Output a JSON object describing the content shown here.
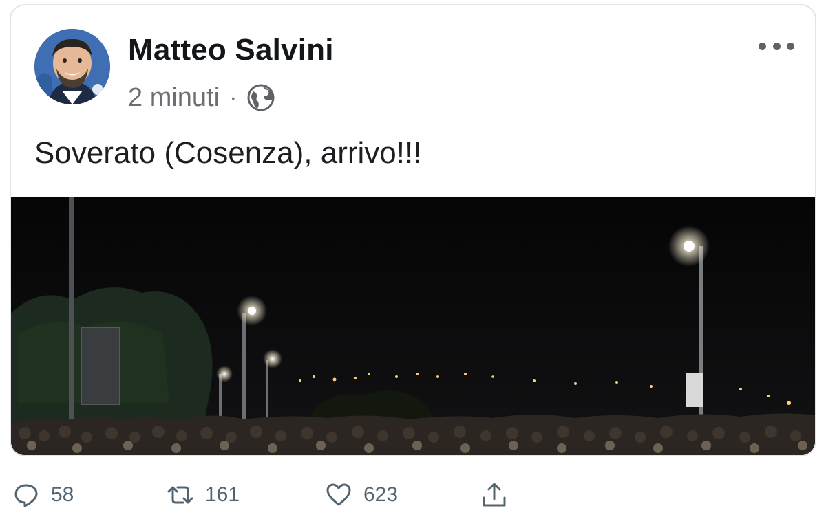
{
  "post": {
    "author": "Matteo Salvini",
    "time": "2 minuti",
    "separator": "·",
    "text": "Soverato (Cosenza), arrivo!!!",
    "privacy_icon": "globe-icon",
    "more_icon": "more-options-icon"
  },
  "actions": {
    "replies": "58",
    "retweets": "161",
    "likes": "623",
    "reply_icon": "reply-icon",
    "retweet_icon": "retweet-icon",
    "like_icon": "heart-icon",
    "share_icon": "share-icon"
  },
  "colors": {
    "text": "#14171a",
    "muted": "#536471",
    "photo_bg": "#070708"
  }
}
